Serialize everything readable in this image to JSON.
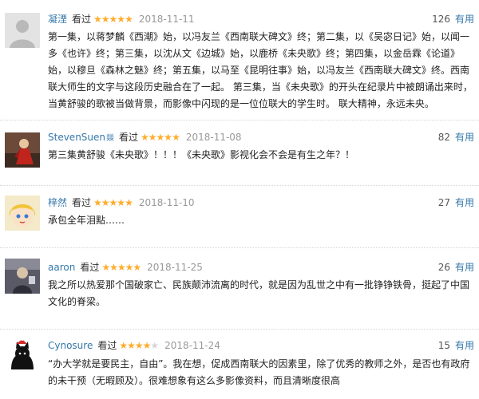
{
  "colors": {
    "link": "#3377aa",
    "star": "#ffac2d",
    "date": "#999999"
  },
  "reviews": [
    {
      "author": "凝湮",
      "author_badge": "",
      "rating_label": "看过",
      "stars": 5,
      "star_glyphs": "★★★★★",
      "date": "2018-11-11",
      "votes": "126",
      "useful_label": "有用",
      "avatar_icon": "default-avatar-icon",
      "content": "第一集，以蒋梦麟《西潮》始，以冯友兰《西南联大碑文》终；第二集，以《吴宓日记》始，以闻一多《也许》终；第三集，以沈从文《边城》始，以鹿桥《未央歌》终；第四集，以金岳霖《论道》始，以穆旦《森林之魅》终；第五集，以马至《昆明往事》始，以冯友兰《西南联大碑文》终。西南联大师生的文字与这段历史融合在了一起。 第三集，当《未央歌》的开头在纪录片中被朗诵出来时，当黄舒骏的歌被当做背景，而影像中闪现的是一位位联大的学生时。 联大精神，永远未央。"
    },
    {
      "author": "StevenSuen",
      "author_badge": "燚",
      "rating_label": "看过",
      "stars": 5,
      "star_glyphs": "★★★★★",
      "date": "2018-11-08",
      "votes": "82",
      "useful_label": "有用",
      "avatar_icon": "red-figure-avatar-icon",
      "content": "第三集黄舒骏《未央歌》！！！《未央歌》影视化会不会是有生之年？！"
    },
    {
      "author": "梓然",
      "author_badge": "",
      "rating_label": "看过",
      "stars": 5,
      "star_glyphs": "★★★★★",
      "date": "2018-11-10",
      "votes": "27",
      "useful_label": "有用",
      "avatar_icon": "anime-blonde-avatar-icon",
      "content": "承包全年泪點……"
    },
    {
      "author": "aaron",
      "author_badge": "",
      "rating_label": "看过",
      "stars": 5,
      "star_glyphs": "★★★★★",
      "date": "2018-11-25",
      "votes": "26",
      "useful_label": "有用",
      "avatar_icon": "photo-avatar-icon",
      "content": "我之所以热爱那个国破家亡、民族颠沛流离的时代，就是因为乱世之中有一批铮铮铁骨，挺起了中国文化的脊梁。"
    },
    {
      "author": "Cynosure",
      "author_badge": "",
      "rating_label": "看过",
      "stars": 4,
      "star_glyphs": "★★★★☆",
      "date": "2018-11-24",
      "votes": "15",
      "useful_label": "有用",
      "avatar_icon": "black-cat-avatar-icon",
      "content": "“办大学就是要民主，自由”。我在想，促成西南联大的因素里，除了优秀的教师之外，是否也有政府的未干预（无暇顾及）。很难想象有这么多影像资料，而且清晰度很高"
    }
  ]
}
